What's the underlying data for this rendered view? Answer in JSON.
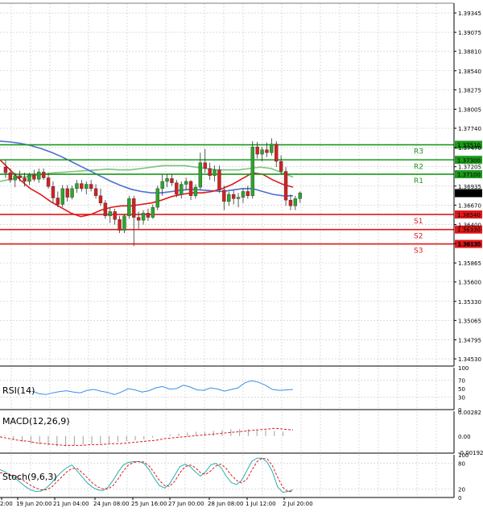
{
  "colors": {
    "grid": "#c8c8c8",
    "axis": "#000000",
    "bull": "#2aa62a",
    "bear": "#d42020",
    "wick": "#333333",
    "ma_blue": "#4a6fd0",
    "ma_red": "#e01818",
    "ma_green": "#7cc47c",
    "resistance": "#1a9a1a",
    "support": "#e01818",
    "rsi_line": "#3a8ee8",
    "macd_hist": "#a0a0a0",
    "macd_signal": "#e01818",
    "stoch_main": "#28b0b0",
    "stoch_signal": "#e01818"
  },
  "chart_data": [
    {
      "type": "candlestick",
      "title": "",
      "price_axis": [
        "1.39345",
        "1.39075",
        "1.38810",
        "1.38540",
        "1.38275",
        "1.38005",
        "1.37740",
        "1.37470",
        "1.37205",
        "1.36935",
        "1.36670",
        "1.36400",
        "1.36135",
        "1.35865",
        "1.35600",
        "1.35330",
        "1.35065",
        "1.34795",
        "1.34530"
      ],
      "ylim": [
        1.3443,
        1.3948
      ],
      "time_axis": [
        "2:00",
        "19 Jun 20:00",
        "21 Jun 04:00",
        "24 Jun 08:00",
        "25 Jun 16:00",
        "27 Jun 00:00",
        "28 Jun 08:00",
        "1 Jul 12:00",
        "2 Jul 20:00"
      ],
      "current_price": "1.36837",
      "levels": [
        {
          "name": "R3",
          "value": "1.37510",
          "kind": "resistance"
        },
        {
          "name": "R2",
          "value": "1.37300",
          "kind": "resistance"
        },
        {
          "name": "R1",
          "value": "1.37100",
          "kind": "resistance"
        },
        {
          "name": "S1",
          "value": "1.36540",
          "kind": "support"
        },
        {
          "name": "S2",
          "value": "1.36330",
          "kind": "support"
        },
        {
          "name": "S3",
          "value": "1.36130",
          "kind": "support"
        }
      ],
      "candles": [
        [
          1.372,
          1.373,
          1.3705,
          1.3712
        ],
        [
          1.3712,
          1.3718,
          1.3698,
          1.3702
        ],
        [
          1.3702,
          1.3712,
          1.3692,
          1.3708
        ],
        [
          1.3708,
          1.3715,
          1.37,
          1.3705
        ],
        [
          1.3705,
          1.3712,
          1.3693,
          1.37
        ],
        [
          1.37,
          1.3712,
          1.3695,
          1.3709
        ],
        [
          1.3709,
          1.3716,
          1.37,
          1.3703
        ],
        [
          1.3703,
          1.3718,
          1.3698,
          1.3713
        ],
        [
          1.3713,
          1.3718,
          1.3702,
          1.3705
        ],
        [
          1.3705,
          1.3712,
          1.369,
          1.3693
        ],
        [
          1.3693,
          1.37,
          1.367,
          1.3677
        ],
        [
          1.3677,
          1.3686,
          1.3664,
          1.3668
        ],
        [
          1.3668,
          1.3695,
          1.3664,
          1.369
        ],
        [
          1.369,
          1.3695,
          1.3672,
          1.3678
        ],
        [
          1.3678,
          1.3694,
          1.3675,
          1.369
        ],
        [
          1.369,
          1.3702,
          1.3684,
          1.3697
        ],
        [
          1.3697,
          1.3702,
          1.3686,
          1.369
        ],
        [
          1.369,
          1.37,
          1.3682,
          1.3696
        ],
        [
          1.3696,
          1.3702,
          1.3686,
          1.369
        ],
        [
          1.369,
          1.3696,
          1.3676,
          1.368
        ],
        [
          1.368,
          1.369,
          1.3666,
          1.367
        ],
        [
          1.367,
          1.3674,
          1.3648,
          1.3652
        ],
        [
          1.3652,
          1.3663,
          1.3642,
          1.3658
        ],
        [
          1.3658,
          1.3662,
          1.364,
          1.3647
        ],
        [
          1.3647,
          1.3652,
          1.3628,
          1.3632
        ],
        [
          1.3632,
          1.3654,
          1.3628,
          1.3652
        ],
        [
          1.3652,
          1.368,
          1.3648,
          1.3676
        ],
        [
          1.3676,
          1.368,
          1.361,
          1.365
        ],
        [
          1.365,
          1.3658,
          1.3634,
          1.3646
        ],
        [
          1.3646,
          1.366,
          1.364,
          1.3656
        ],
        [
          1.3656,
          1.3662,
          1.3645,
          1.365
        ],
        [
          1.365,
          1.3668,
          1.3648,
          1.3664
        ],
        [
          1.3664,
          1.3694,
          1.366,
          1.369
        ],
        [
          1.369,
          1.371,
          1.368,
          1.37
        ],
        [
          1.37,
          1.371,
          1.3692,
          1.3704
        ],
        [
          1.3704,
          1.371,
          1.3694,
          1.3698
        ],
        [
          1.3698,
          1.3702,
          1.3678,
          1.3682
        ],
        [
          1.3682,
          1.37,
          1.3676,
          1.3696
        ],
        [
          1.3696,
          1.3705,
          1.3688,
          1.37
        ],
        [
          1.37,
          1.3702,
          1.3674,
          1.368
        ],
        [
          1.368,
          1.3696,
          1.3676,
          1.3692
        ],
        [
          1.3692,
          1.374,
          1.3688,
          1.3726
        ],
        [
          1.3726,
          1.3745,
          1.3712,
          1.3718
        ],
        [
          1.3718,
          1.3726,
          1.3702,
          1.3708
        ],
        [
          1.3708,
          1.3722,
          1.37,
          1.3716
        ],
        [
          1.3716,
          1.3722,
          1.3684,
          1.3688
        ],
        [
          1.3688,
          1.3694,
          1.366,
          1.3672
        ],
        [
          1.3672,
          1.3686,
          1.3666,
          1.3682
        ],
        [
          1.3682,
          1.3688,
          1.3668,
          1.3676
        ],
        [
          1.3676,
          1.3684,
          1.3664,
          1.3678
        ],
        [
          1.3678,
          1.369,
          1.367,
          1.3686
        ],
        [
          1.3686,
          1.3694,
          1.3676,
          1.368
        ],
        [
          1.368,
          1.3756,
          1.3676,
          1.3748
        ],
        [
          1.3748,
          1.3755,
          1.3732,
          1.3738
        ],
        [
          1.3738,
          1.3748,
          1.3728,
          1.3744
        ],
        [
          1.3744,
          1.3754,
          1.3734,
          1.374
        ],
        [
          1.374,
          1.376,
          1.3736,
          1.3752
        ],
        [
          1.3752,
          1.3756,
          1.372,
          1.3728
        ],
        [
          1.3728,
          1.3736,
          1.371,
          1.3714
        ],
        [
          1.3714,
          1.372,
          1.3666,
          1.3674
        ],
        [
          1.3674,
          1.3682,
          1.366,
          1.3666
        ],
        [
          1.3666,
          1.368,
          1.366,
          1.3676
        ],
        [
          1.3676,
          1.3686,
          1.367,
          1.3684
        ]
      ],
      "ma_blue": [
        1.3756,
        1.3755,
        1.3753,
        1.375,
        1.3746,
        1.3741,
        1.3735,
        1.3728,
        1.3721,
        1.3714,
        1.3707,
        1.37,
        1.3694,
        1.3689,
        1.3686,
        1.3684,
        1.3684,
        1.3686,
        1.3688,
        1.3689,
        1.3688,
        1.3687,
        1.3686,
        1.3688,
        1.369,
        1.369,
        1.3686,
        1.3682,
        1.368,
        1.368
      ],
      "ma_red": [
        1.373,
        1.3716,
        1.3702,
        1.369,
        1.3682,
        1.3672,
        1.3664,
        1.3656,
        1.3651,
        1.3654,
        1.366,
        1.3664,
        1.3666,
        1.3666,
        1.3668,
        1.367,
        1.3674,
        1.3679,
        1.3682,
        1.3684,
        1.3684,
        1.3686,
        1.369,
        1.3696,
        1.3704,
        1.3712,
        1.371,
        1.3702,
        1.3696,
        1.3692
      ],
      "ma_green": [
        1.37,
        1.3703,
        1.3706,
        1.3708,
        1.371,
        1.3712,
        1.3713,
        1.3714,
        1.3715,
        1.3716,
        1.3717,
        1.3716,
        1.3716,
        1.3718,
        1.372,
        1.3722,
        1.3722,
        1.3722,
        1.372,
        1.3718,
        1.3716,
        1.3716,
        1.3716,
        1.3718,
        1.372,
        1.3718,
        1.3712,
        1.3706
      ]
    },
    {
      "type": "line",
      "title": "RSI(14)",
      "axis": [
        "100",
        "70",
        "50",
        "30",
        "0"
      ],
      "ylim": [
        0,
        100
      ],
      "values": [
        44,
        38,
        36,
        40,
        43,
        45,
        42,
        40,
        46,
        48,
        44,
        41,
        36,
        42,
        50,
        47,
        42,
        45,
        52,
        55,
        49,
        50,
        58,
        54,
        47,
        46,
        52,
        49,
        44,
        48,
        52,
        64,
        69,
        65,
        58,
        48,
        46,
        47,
        48
      ]
    },
    {
      "type": "bar",
      "title": "MACD(12,26,9)",
      "axis": [
        "0.00282",
        "0.00",
        "-0.001929"
      ],
      "ylim": [
        -0.002,
        0.0029
      ],
      "histogram": [
        0.0001,
        -0.0004,
        -0.0007,
        -0.0009,
        -0.001,
        -0.0011,
        -0.0012,
        -0.0012,
        -0.0011,
        -0.001,
        -0.0009,
        -0.0009,
        -0.0008,
        -0.0007,
        -0.0006,
        -0.0005,
        -0.0004,
        -0.0002,
        0.0,
        0.0002,
        0.0003,
        0.0004,
        0.0005,
        0.0005,
        0.0006,
        0.0007,
        0.0008,
        0.0008,
        0.0008,
        0.0007,
        0.0007,
        0.0006,
        0.0005
      ],
      "signal": [
        -0.0001,
        -0.0003,
        -0.0005,
        -0.0006,
        -0.0008,
        -0.0009,
        -0.001,
        -0.0011,
        -0.0011,
        -0.0011,
        -0.001,
        -0.001,
        -0.0009,
        -0.0009,
        -0.0008,
        -0.0007,
        -0.0006,
        -0.0005,
        -0.0003,
        -0.0002,
        -0.0001,
        0.0,
        0.0001,
        0.0002,
        0.0003,
        0.0004,
        0.0005,
        0.0006,
        0.0007,
        0.0008,
        0.0009,
        0.0008,
        0.0007
      ]
    },
    {
      "type": "line",
      "title": "Stoch(9,6,3)",
      "axis": [
        "100",
        "80",
        "20",
        "0"
      ],
      "ylim": [
        0,
        100
      ],
      "main": [
        65,
        60,
        52,
        45,
        35,
        25,
        18,
        14,
        15,
        22,
        34,
        48,
        60,
        70,
        76,
        62,
        48,
        34,
        24,
        18,
        16,
        24,
        40,
        60,
        76,
        82,
        84,
        84,
        80,
        65,
        45,
        28,
        22,
        32,
        52,
        72,
        78,
        72,
        60,
        50,
        60,
        76,
        80,
        70,
        50,
        35,
        30,
        40,
        62,
        85,
        92,
        92,
        82,
        60,
        25,
        12,
        14,
        18
      ],
      "signal": [
        58,
        56,
        54,
        50,
        44,
        36,
        28,
        22,
        18,
        18,
        24,
        36,
        48,
        60,
        68,
        68,
        58,
        46,
        34,
        25,
        20,
        20,
        28,
        44,
        62,
        76,
        82,
        84,
        83,
        74,
        58,
        40,
        28,
        26,
        38,
        58,
        72,
        76,
        70,
        58,
        54,
        62,
        74,
        78,
        68,
        52,
        40,
        34,
        42,
        64,
        84,
        92,
        90,
        74,
        48,
        24,
        14,
        14
      ]
    }
  ]
}
